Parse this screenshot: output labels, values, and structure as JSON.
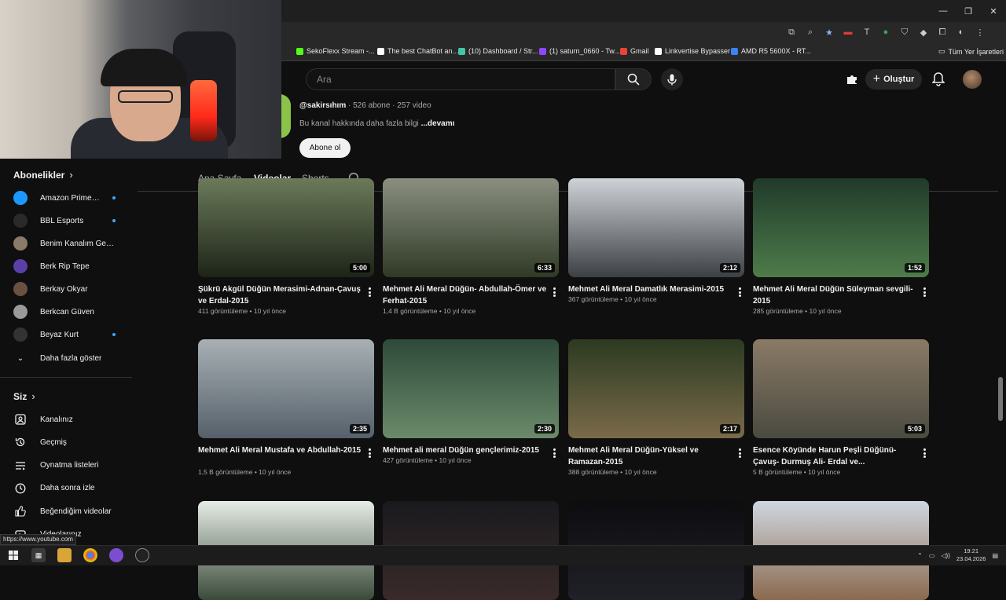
{
  "browser": {
    "window_controls": [
      "—",
      "❐",
      "✕"
    ],
    "bookmarks": [
      {
        "label": "SekoFlexx Stream -...",
        "color": "#53fc18"
      },
      {
        "label": "The best ChatBot an...",
        "color": "#ffffff"
      },
      {
        "label": "(10) Dashboard / Str...",
        "color": "#3ec7a8"
      },
      {
        "label": "(1) saturn_0660 - Tw...",
        "color": "#9146ff"
      },
      {
        "label": "Gmail",
        "color": "#ea4335"
      },
      {
        "label": "Linkvertise Bypasser",
        "color": "#ffffff"
      },
      {
        "label": "AMD R5 5600X - RT...",
        "color": "#3b82f6"
      }
    ],
    "all_bookmarks_label": "Tüm Yer İşaretleri",
    "status_url": "https://www.youtube.com"
  },
  "header": {
    "search_placeholder": "Ara",
    "create_label": "Oluştur"
  },
  "channel": {
    "handle": "@sakirsıhım",
    "stats": "· 526 abone · 257 video",
    "about": "Bu kanal hakkında daha fazla bilgi",
    "more": "...devamı",
    "subscribe_label": "Abone ol"
  },
  "tabs": [
    {
      "label": "Ana Sayfa",
      "active": false
    },
    {
      "label": "Videolar",
      "active": true
    },
    {
      "label": "Shorts",
      "active": false
    }
  ],
  "sidebar": {
    "subs_header": "Abonelikler",
    "subs": [
      {
        "label": "Amazon Prime V...",
        "color": "#1a98ff",
        "new": true
      },
      {
        "label": "BBL Esports",
        "color": "#2a2a2a",
        "new": true
      },
      {
        "label": "Benim Kanalım Gez...",
        "color": "#8a7a6a",
        "new": false
      },
      {
        "label": "Berk Rip Tepe",
        "color": "#5b3fa8",
        "new": false
      },
      {
        "label": "Berkay Okyar",
        "color": "#6a5040",
        "new": false
      },
      {
        "label": "Berkcan Güven",
        "color": "#9a9a9a",
        "new": false
      },
      {
        "label": "Beyaz Kurt",
        "color": "#333333",
        "new": true
      }
    ],
    "show_more": "Daha fazla göster",
    "you_header": "Siz",
    "you_items": [
      {
        "label": "Kanalınız",
        "icon": "channel-icon"
      },
      {
        "label": "Geçmiş",
        "icon": "history-icon"
      },
      {
        "label": "Oynatma listeleri",
        "icon": "playlist-icon"
      },
      {
        "label": "Daha sonra izle",
        "icon": "watch-later-icon"
      },
      {
        "label": "Beğendiğim videolar",
        "icon": "like-icon"
      },
      {
        "label": "Videolarınız",
        "icon": "videos-icon"
      }
    ]
  },
  "videos": [
    {
      "title": "Şükrü Akgül Düğün Merasimi-Adnan-Çavuş ve Erdal-2015",
      "views": "411 görüntüleme",
      "age": "10 yıl önce",
      "duration": "5:00",
      "c1": "#6b7a5a",
      "c2": "#1d2418"
    },
    {
      "title": "Mehmet Ali Meral Düğün- Abdullah-Ömer ve Ferhat-2015",
      "views": "1,4 B görüntüleme",
      "age": "10 yıl önce",
      "duration": "6:33",
      "c1": "#8a8f80",
      "c2": "#2f3a26"
    },
    {
      "title": "Mehmet Ali Meral Damatlık Merasimi-2015",
      "views": "367 görüntüleme",
      "age": "10 yıl önce",
      "duration": "2:12",
      "c1": "#cfd2d6",
      "c2": "#3c3f44"
    },
    {
      "title": "Mehmet Ali Meral Düğün Süleyman sevgili-2015",
      "views": "285 görüntüleme",
      "age": "10 yıl önce",
      "duration": "1:52",
      "c1": "#203a2a",
      "c2": "#4e7c4a"
    },
    {
      "title": "Mehmet Ali Meral Mustafa ve Abdullah-2015",
      "views": "1,5 B görüntüleme",
      "age": "10 yıl önce",
      "duration": "2:35",
      "c1": "#a8b0b4",
      "c2": "#55606a"
    },
    {
      "title": "Mehmet ali meral Düğün gençlerimiz-2015",
      "views": "427 görüntüleme",
      "age": "10 yıl önce",
      "duration": "2:30",
      "c1": "#2e4a3a",
      "c2": "#6b8a6a"
    },
    {
      "title": "Mehmet Ali Meral Düğün-Yüksel ve Ramazan-2015",
      "views": "388 görüntüleme",
      "age": "10 yıl önce",
      "duration": "2:17",
      "c1": "#2b3a20",
      "c2": "#7a6a4a"
    },
    {
      "title": "Esence Köyünde Harun Peşli Düğünü-Çavuş- Durmuş Ali- Erdal ve...",
      "views": "5 B görüntüleme",
      "age": "10 yıl önce",
      "duration": "5:03",
      "c1": "#8a7a66",
      "c2": "#4a4a40"
    },
    {
      "title": "",
      "views": "",
      "age": "",
      "duration": "",
      "c1": "#e6ece6",
      "c2": "#3a4a3a"
    },
    {
      "title": "",
      "views": "",
      "age": "",
      "duration": "",
      "c1": "#1a1a1e",
      "c2": "#3a2a2a"
    },
    {
      "title": "",
      "views": "",
      "age": "",
      "duration": "",
      "c1": "#0d0d10",
      "c2": "#202028"
    },
    {
      "title": "",
      "views": "",
      "age": "",
      "duration": "",
      "c1": "#cfd6e0",
      "c2": "#8a6a4e"
    }
  ],
  "taskbar": {
    "time": "19:21",
    "date": "23.04.2026"
  }
}
